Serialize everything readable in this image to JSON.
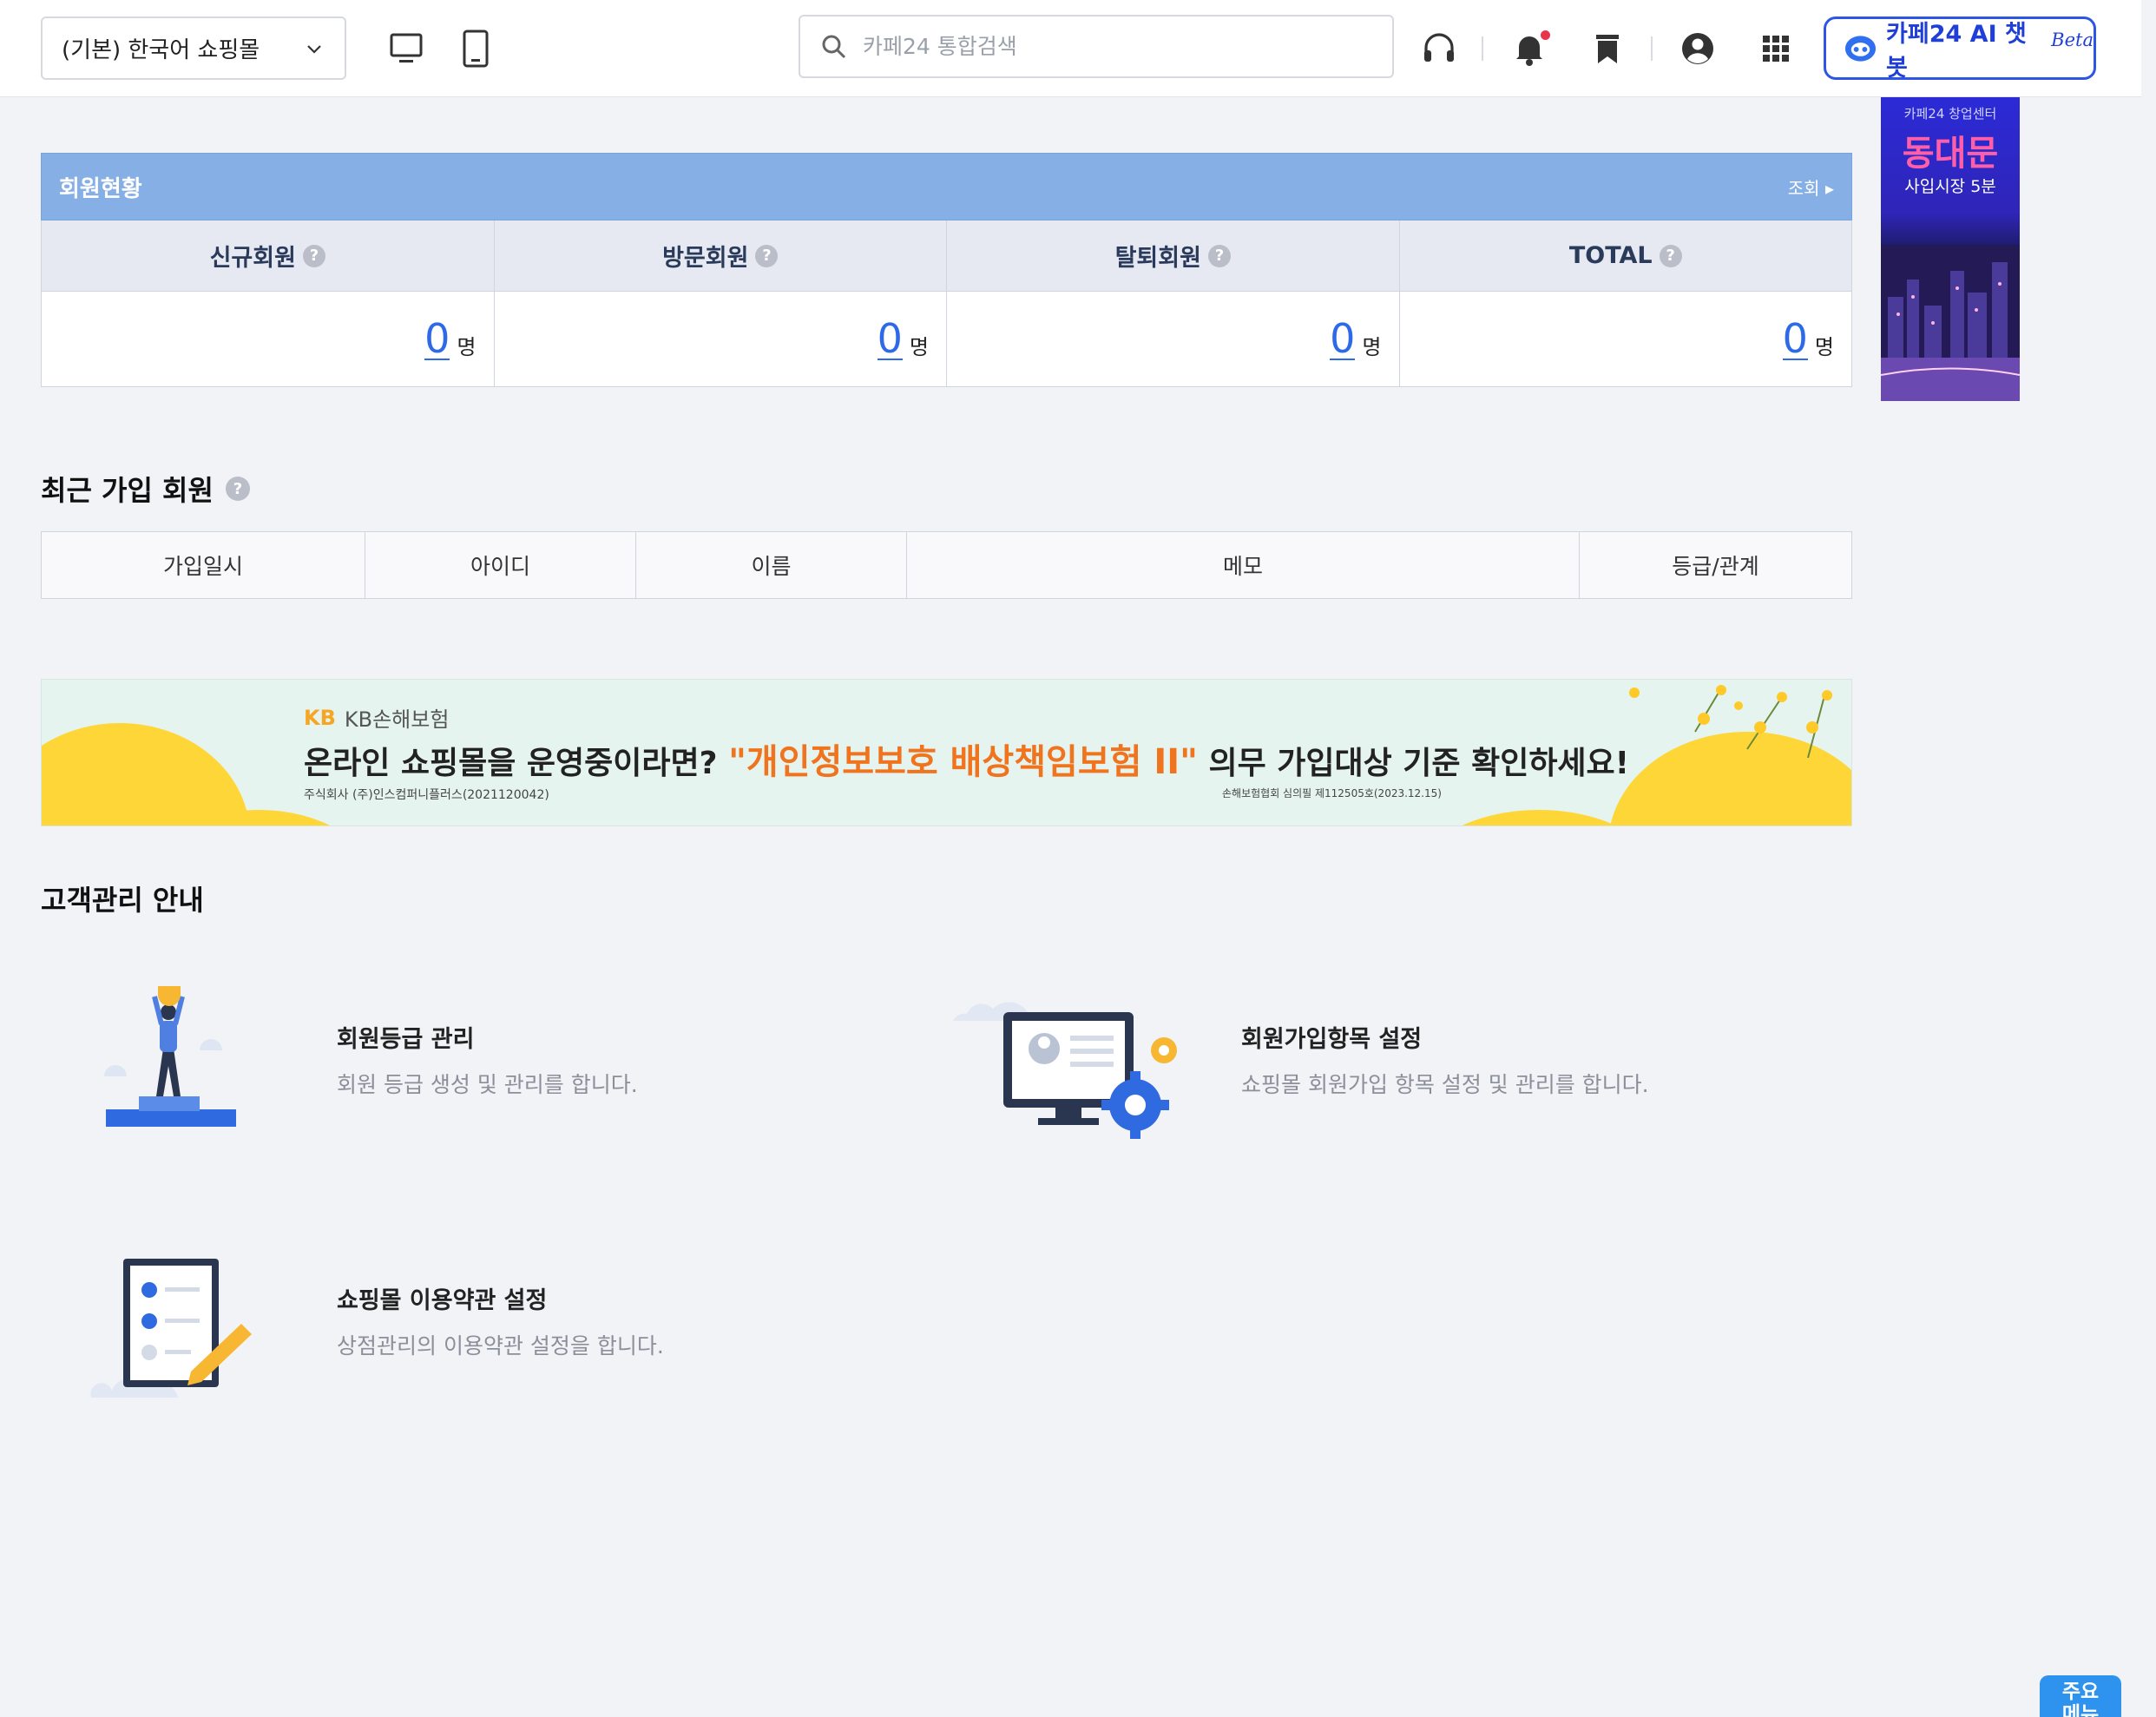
{
  "topbar": {
    "mall_select": "(기본) 한국어 쇼핑몰",
    "search_placeholder": "카페24 통합검색",
    "ai_chatbot_label": "카페24 AI 챗봇",
    "ai_chatbot_badge": "Beta",
    "icons": [
      "pc-view-icon",
      "mobile-view-icon",
      "search-icon",
      "headset-icon",
      "bell-icon",
      "bookmark-icon",
      "user-icon",
      "apps-grid-icon",
      "chatbot-icon"
    ]
  },
  "side_ad": {
    "line1": "카페24 창업센터",
    "line2": "동대문",
    "line3": "사입시장 5분"
  },
  "member_status": {
    "title": "회원현황",
    "view_link": "조회",
    "columns": [
      {
        "label": "신규회원",
        "value": "0",
        "unit": "명"
      },
      {
        "label": "방문회원",
        "value": "0",
        "unit": "명"
      },
      {
        "label": "탈퇴회원",
        "value": "0",
        "unit": "명"
      },
      {
        "label": "TOTAL",
        "value": "0",
        "unit": "명"
      }
    ]
  },
  "recent_members": {
    "title": "최근 가입 회원",
    "headers": [
      "가입일시",
      "아이디",
      "이름",
      "메모",
      "등급/관계"
    ]
  },
  "banner": {
    "brand": "KB손해보험",
    "brand_mark": "KB",
    "headline_pre": "온라인 쇼핑몰을 운영중이라면?",
    "headline_highlight": "\"개인정보보호 배상책임보험 II\"",
    "headline_post": "의무 가입대상 기준 확인하세요!",
    "fine_left": "주식회사 (주)인스컴퍼니플러스(2021120042)",
    "fine_right": "손해보험협회 심의필 제112505호(2023.12.15)"
  },
  "guide": {
    "title": "고객관리 안내",
    "items": [
      {
        "title": "회원등급 관리",
        "desc": "회원 등급 생성 및 관리를 합니다."
      },
      {
        "title": "회원가입항목 설정",
        "desc": "쇼핑몰 회원가입 항목 설정 및 관리를 합니다."
      },
      {
        "title": "쇼핑몰 이용약관 설정",
        "desc": "상점관리의 이용약관 설정을 합니다."
      }
    ]
  },
  "float_menu": {
    "line1": "주요",
    "line2": "메뉴"
  },
  "colors": {
    "accent_blue": "#2e6ae8",
    "status_header": "#86afe6",
    "banner_highlight": "#f0731e",
    "ai_border": "#2e56e6"
  }
}
